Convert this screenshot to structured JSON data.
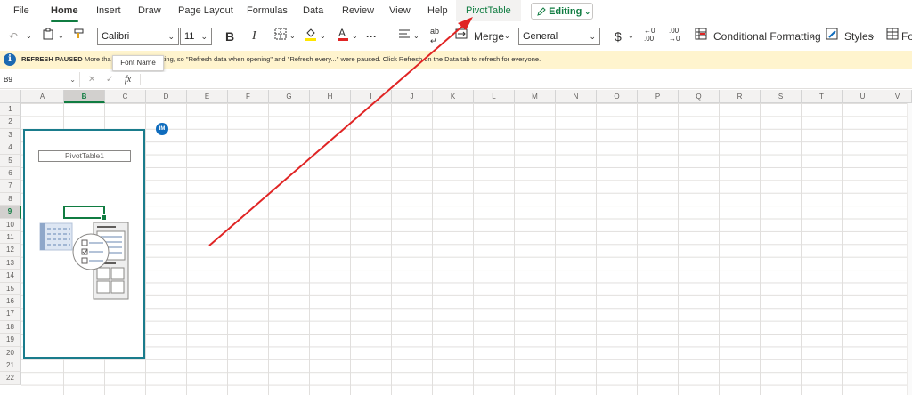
{
  "tabs": [
    "File",
    "Home",
    "Insert",
    "Draw",
    "Page Layout",
    "Formulas",
    "Data",
    "Review",
    "View",
    "Help",
    "PivotTable"
  ],
  "editing_label": "Editing",
  "toolbar": {
    "font_name": "Calibri",
    "font_size": "11",
    "merge_label": "Merge",
    "number_format": "General",
    "conditional_formatting": "Conditional Formatting",
    "styles": "Styles",
    "overflow": "Fo"
  },
  "tooltip": "Font Name",
  "notice": {
    "title": "REFRESH PAUSED",
    "message_a": "More tha",
    "message_b": "iting, so \"Refresh data when opening\" and \"Refresh every...\" were paused. Click Refresh on the Data tab to refresh for everyone."
  },
  "name_box": "B9",
  "formula_symbol": "fx",
  "columns": [
    "A",
    "B",
    "C",
    "D",
    "E",
    "F",
    "G",
    "H",
    "I",
    "J",
    "K",
    "L",
    "M",
    "N",
    "O",
    "P",
    "Q",
    "R",
    "S",
    "T",
    "U",
    "V"
  ],
  "rows": [
    "1",
    "2",
    "3",
    "4",
    "5",
    "6",
    "7",
    "8",
    "9",
    "10",
    "11",
    "12",
    "13",
    "14",
    "15",
    "16",
    "17",
    "18",
    "19",
    "20",
    "21",
    "22"
  ],
  "selected_column": "B",
  "selected_row": "9",
  "pivot_table_name": "PivotTable1",
  "avatar_initials": "IM",
  "colors": {
    "accent": "#107c41",
    "pivot_border": "#1a7c8c",
    "arrow": "#e02424",
    "notice_bg": "#fff4ce"
  }
}
